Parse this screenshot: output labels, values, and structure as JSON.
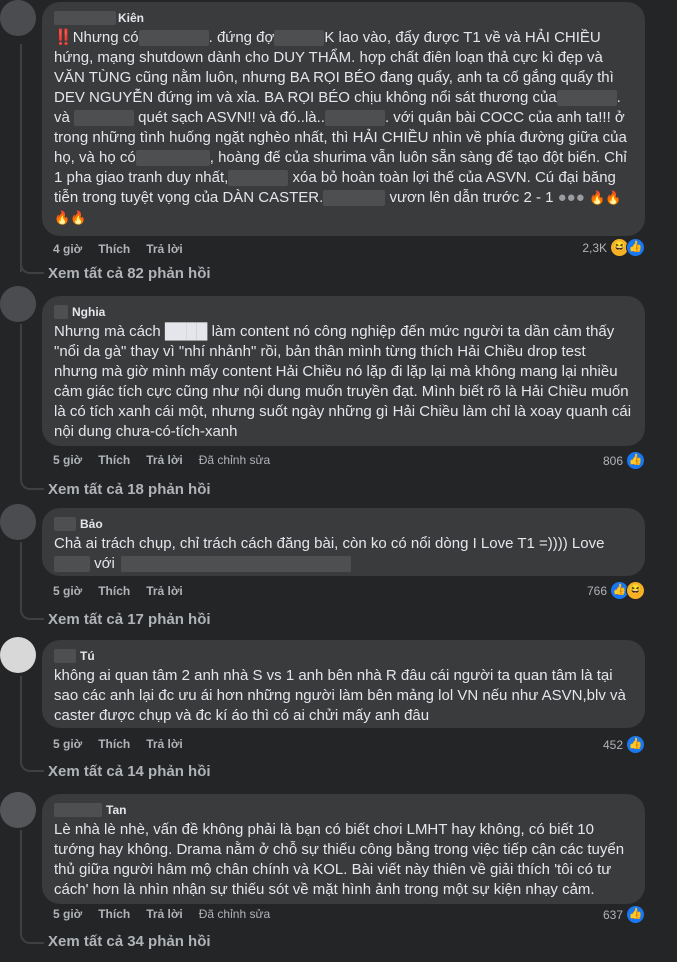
{
  "comments": [
    {
      "author": "Kiên",
      "text": "Nhưng có ████ đứng đợ███K lao vào, đẩy được T1 về và HẢI CHIỀU hứng, mạng shutdown dành cho DUY THẨM. hợp chất điên loạn thả cực kì đẹp và VĂN TÙNG cũng nằm luôn, nhưng BA RỌI BÉO đang quẩy, anh ta cố gắng quẩy thì DEV NGUYỄN đứng im và xỉa. BA RỌI BÉO chịu không nổi sát thương của ████ và ████ quét sạch ASVN!! và đó..là.. ████ với quân bài COCC của anh ta!!! ở trong những tình huống ngặt nghèo nhất, thì HẢI CHIỀU nhìn về phía đường giữa của họ, và họ có ████, hoàng đế của shurima vẫn luôn sẵn sàng để tạo đột biến. Chỉ 1 pha giao tranh duy nhất, ████ xóa bỏ hoàn toàn lợi thế của ASVN. Cú đại băng tiễn trong tuyệt vọng của DÀN CASTER. ████ vươn lên dẫn trước 2 - 1",
      "time": "4 giờ",
      "like": "Thích",
      "reply": "Trả lời",
      "edited": "",
      "count": "2,3K",
      "replies": "Xem tất cả 82 phản hồi"
    },
    {
      "author": "Nghia",
      "text": "Nhưng mà cách ████ làm content nó công nghiệp đến mức người ta dần cảm thấy \"nổi da gà\" thay vì \"nhí nhảnh\" rồi, bản thân mình từng thích Hải Chiều drop test nhưng mà giờ mình mấy content Hải Chiều nó lặp đi lặp lại mà không mang lại nhiều cảm giác tích cực cũng như nội dung muốn truyền đạt. Mình biết rõ là Hải Chiều muốn là có tích xanh cái một, nhưng suốt ngày những gì Hải Chiều làm chỉ là xoay quanh cái nội dung chưa-có-tích-xanh",
      "time": "5 giờ",
      "like": "Thích",
      "reply": "Trả lời",
      "edited": "Đã chỉnh sửa",
      "count": "806",
      "replies": "Xem tất cả 18 phản hồi"
    },
    {
      "author": "Bảo",
      "text": "Chả ai trách chụp, chỉ trách cách đăng bài, còn ko có nổi dòng I Love T1 =)))) Love ████ với",
      "time": "5 giờ",
      "like": "Thích",
      "reply": "Trả lời",
      "edited": "",
      "count": "766",
      "replies": "Xem tất cả 17 phản hồi"
    },
    {
      "author": "Tú",
      "text": "không ai quan tâm 2 anh nhà S vs 1 anh bên nhà R đâu cái người ta quan tâm là tại sao các anh lại đc ưu ái hơn những người làm bên mảng lol VN nếu như ASVN,blv và caster được chụp và đc kí áo thì có ai chửi mấy anh đâu",
      "time": "5 giờ",
      "like": "Thích",
      "reply": "Trả lời",
      "edited": "",
      "count": "452",
      "replies": "Xem tất cả 14 phản hồi"
    },
    {
      "author": "Tan",
      "text": "Lè nhà lè nhè, vấn đề không phải là bạn có biết chơi LMHT hay không, có biết 10 tướng hay không. Drama nằm ở chỗ sự thiếu công bằng trong việc tiếp cận các tuyển thủ giữa người hâm mộ chân chính và KOL. Bài viết này thiên về giải thích 'tôi có tư cách' hơn là nhìn nhận sự thiếu sót về mặt hình ảnh trong một sự kiện nhạy cảm.",
      "time": "5 giờ",
      "like": "Thích",
      "reply": "Trả lời",
      "edited": "Đã chỉnh sửa",
      "count": "637",
      "replies": "Xem tất cả 34 phản hồi"
    }
  ],
  "colors": {
    "background": "#242526",
    "bubble": "#3a3b3c",
    "text": "#e4e6eb",
    "muted": "#b0b3b8",
    "like": "#1877f2"
  }
}
